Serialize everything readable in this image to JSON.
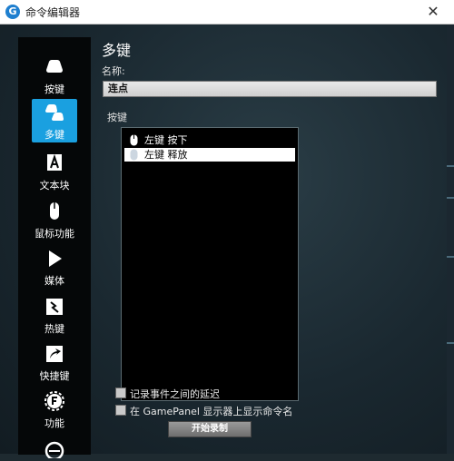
{
  "window": {
    "title": "命令编辑器",
    "app_icon": "logitech-g-icon",
    "close_glyph": "✕"
  },
  "sidebar": {
    "items": [
      {
        "label": "按键",
        "icon": "keyboard-key-icon",
        "active": false
      },
      {
        "label": "多键",
        "icon": "multi-key-icon",
        "active": true
      },
      {
        "label": "文本块",
        "icon": "text-block-icon",
        "active": false
      },
      {
        "label": "鼠标功能",
        "icon": "mouse-icon",
        "active": false
      },
      {
        "label": "媒体",
        "icon": "play-icon",
        "active": false
      },
      {
        "label": "热键",
        "icon": "hotkey-icon",
        "active": false
      },
      {
        "label": "快捷键",
        "icon": "shortcut-arrow-icon",
        "active": false
      },
      {
        "label": "功能",
        "icon": "function-gear-icon",
        "active": false
      }
    ]
  },
  "main": {
    "heading": "多键",
    "name_label": "名称:",
    "name_value": "连点",
    "keys_label": "按键",
    "key_events": [
      {
        "text": "左键 按下",
        "icon": "mouse-icon",
        "selected": false
      },
      {
        "text": "左键 释放",
        "icon": "mouse-icon",
        "selected": true
      }
    ],
    "options": [
      {
        "label": "记录事件之间的延迟",
        "checked": false
      },
      {
        "label": "在 GamePanel 显示器上显示命令名",
        "checked": false
      }
    ],
    "record_button": "开始录制"
  },
  "colors": {
    "accent": "#1aa0e0",
    "sidebar_bg": "#050708",
    "list_bg": "#000000"
  }
}
